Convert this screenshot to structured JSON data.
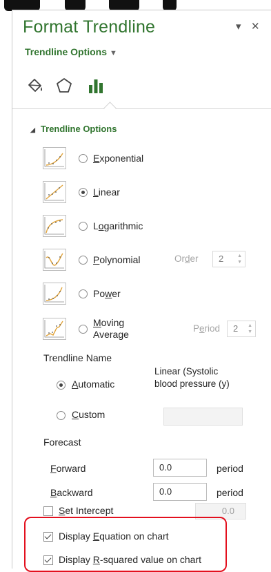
{
  "pane": {
    "title": "Format Trendline",
    "subtitle": "Trendline Options",
    "pin_glyph": "▾",
    "close_glyph": "✕",
    "tabs": [
      "fill-line-icon",
      "effects-icon",
      "trendline-options-icon"
    ]
  },
  "section": {
    "title": "Trendline Options"
  },
  "trend_types": [
    {
      "pre": "",
      "key": "E",
      "post": "xponential",
      "selected": false
    },
    {
      "pre": "",
      "key": "L",
      "post": "inear",
      "selected": true
    },
    {
      "pre": "L",
      "key": "o",
      "post": "garithmic",
      "selected": false
    },
    {
      "pre": "",
      "key": "P",
      "post": "olynomial",
      "selected": false
    },
    {
      "pre": "Po",
      "key": "w",
      "post": "er",
      "selected": false
    },
    {
      "pre": "",
      "key": "M",
      "post": "oving",
      "line2": "Average",
      "selected": false
    }
  ],
  "order": {
    "pre": "Or",
    "key": "d",
    "post": "er",
    "value": "2"
  },
  "period": {
    "pre": "P",
    "key": "e",
    "post": "riod",
    "value": "2"
  },
  "trendline_name": {
    "heading": "Trendline Name",
    "automatic": {
      "key": "A",
      "post": "utomatic",
      "selected": true
    },
    "auto_value_line1": "Linear (Systolic",
    "auto_value_line2": "blood pressure (y)",
    "custom": {
      "key": "C",
      "post": "ustom",
      "selected": false
    },
    "custom_value": ""
  },
  "forecast": {
    "heading": "Forecast",
    "forward": {
      "key": "F",
      "post": "orward",
      "value": "0.0",
      "unit": "period"
    },
    "backward": {
      "key": "B",
      "post": "ackward",
      "value": "0.0",
      "unit": "period"
    }
  },
  "intercept": {
    "key": "S",
    "post": "et Intercept",
    "checked": false,
    "value": "0.0"
  },
  "display_equation": {
    "pre": "Display ",
    "key": "E",
    "post": "quation on chart",
    "checked": true
  },
  "display_rsq": {
    "pre": "Display ",
    "key": "R",
    "post": "-squared value on chart",
    "checked": true
  },
  "colors": {
    "accent_green": "#31752f",
    "highlight_red": "#e3101e"
  }
}
